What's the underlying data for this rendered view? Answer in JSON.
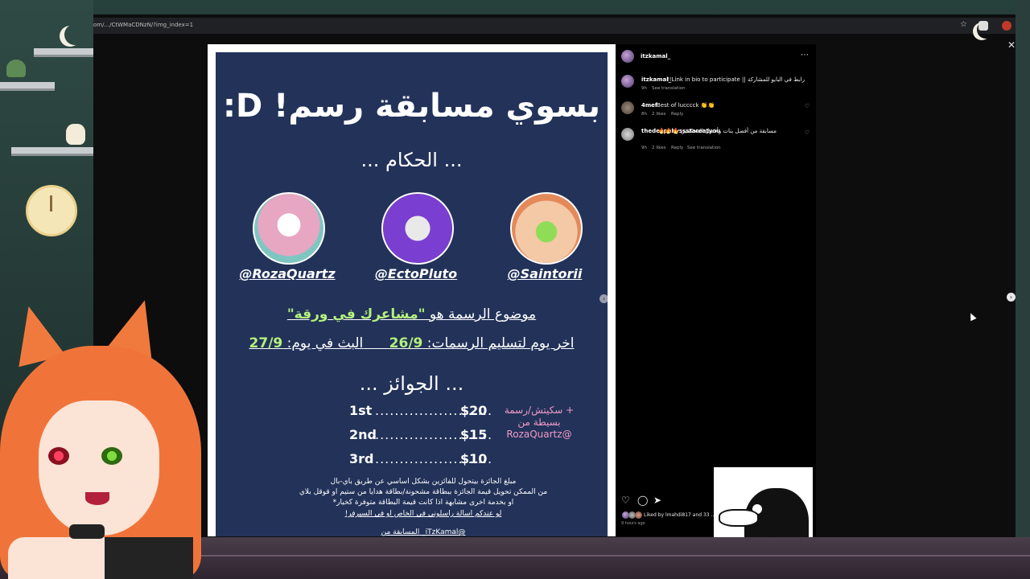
{
  "browser": {
    "url": "om/.../CtWMaCDNzN/?img_index=1",
    "star_icon": "star-icon",
    "close_icon": "close-icon"
  },
  "poster": {
    "title": "بسوي مسابقة رسم! D:",
    "judges_heading": "... الحكام ...",
    "judges": [
      "@RozaQuartz",
      "@EctoPluto",
      "@Saintorii"
    ],
    "topic_prefix": "موضوع الرسمة هو ",
    "topic_value": "\"مشاعرك في ورقة\"",
    "deadline_label": "اخر يوم لتسليم الرسمات: ",
    "deadline_value": "26/9",
    "stream_label": "البث في يوم: ",
    "stream_value": "27/9",
    "prizes_heading": "... الجوائز ...",
    "prizes": [
      {
        "place": "1st",
        "dots": "........................",
        "amount": "$20"
      },
      {
        "place": "2nd",
        "dots": "........................",
        "amount": "$15"
      },
      {
        "place": "3rd",
        "dots": "........................",
        "amount": "$10"
      }
    ],
    "bonus": "+ سكيتش/رسمة بسيطة من @RozaQuartz",
    "fine_1": "مبلغ الجائزة بيتحول للفائزين بشكل اساسي عن طريق باي-بال",
    "fine_2": "من الممكن تحويل قيمة الجائزة ببطاقة مشحونة/بطاقة هدايا من ستيم او قوقل بلاي",
    "fine_3": "او بخدمة اخرى مشابهة اذا كانت قيمة البطاقة متوفرة كخيار*",
    "fine_4": "لو عندكم اسالة راسلوني في الخاص او في السيرفر!",
    "fine_5": "@iTzKamal_ المسابقة من"
  },
  "panel": {
    "author": "itzkamal_",
    "more_icon": "more-icon",
    "caption_user": "itzkamal_",
    "caption_text": "!!Link in bio to participate || رابط في البايو للمشاركة",
    "caption_time": "9h",
    "caption_translate": "See translation",
    "comments": [
      {
        "user": "4mef",
        "text": "Best of lucccck 👏👏",
        "time": "8h",
        "likes": "2 likes",
        "reply": "Reply",
        "translate": ""
      },
      {
        "user": "thedeepabyssstareatyou",
        "text": "مسابقة من أفضل بنات وأفضل المحكمين 🔥🔥🔥",
        "time": "9h",
        "likes": "2 likes",
        "reply": "Reply",
        "translate": "See translation"
      }
    ],
    "liked_by": "Liked by lmahdi817 and 33 ...",
    "ago": "9 hours ago"
  },
  "colors": {
    "poster_bg": "#223259",
    "accent_green": "#b5f07d",
    "accent_pink": "#f29ac8"
  }
}
